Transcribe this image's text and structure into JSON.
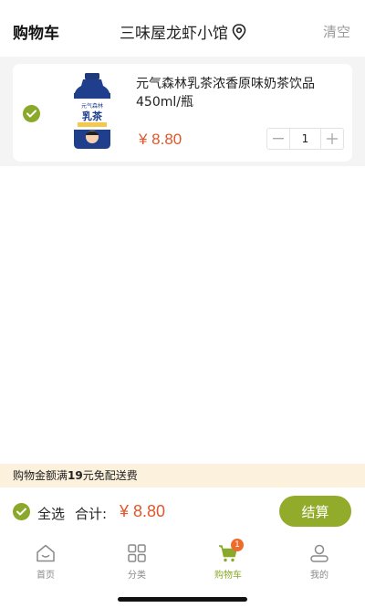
{
  "header": {
    "title": "购物车",
    "store_name": "三味屋龙虾小馆",
    "clear_label": "清空"
  },
  "cart": {
    "items": [
      {
        "name": "元气森林乳茶浓香原味奶茶饮品450ml/瓶",
        "price": "¥ 8.80",
        "quantity": "1",
        "checked": true,
        "image_label_top": "元气森林",
        "image_label_main": "乳茶"
      }
    ]
  },
  "promo": {
    "prefix": "购物金额满",
    "amount": "19",
    "suffix": "元免配送费"
  },
  "footer": {
    "select_all_label": "全选",
    "total_label": "合计:",
    "total_value": "¥ 8.80",
    "checkout_label": "结算"
  },
  "tabbar": {
    "tabs": [
      {
        "label": "首页",
        "icon": "home-icon"
      },
      {
        "label": "分类",
        "icon": "grid-icon"
      },
      {
        "label": "购物车",
        "icon": "cart-icon",
        "badge": "1",
        "active": true
      },
      {
        "label": "我的",
        "icon": "user-icon"
      }
    ]
  },
  "colors": {
    "accent": "#8aa82a",
    "price": "#e0572b",
    "badge": "#ef6b2c",
    "promo_bg": "#fbf1dc"
  }
}
